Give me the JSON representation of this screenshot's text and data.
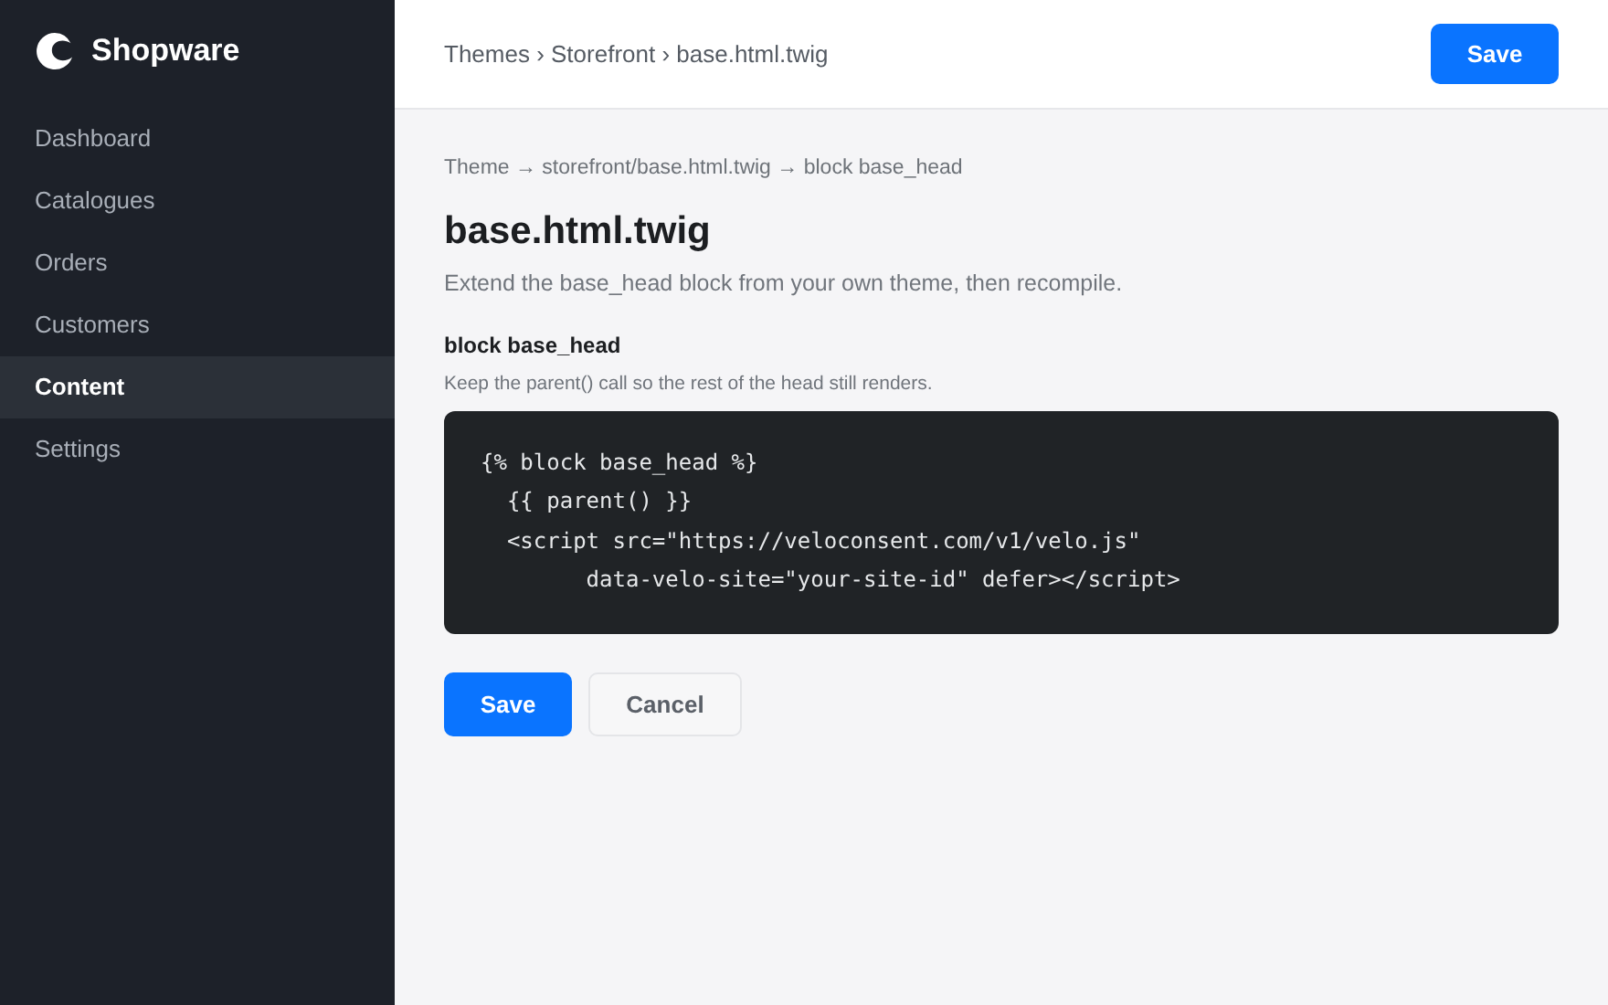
{
  "sidebar": {
    "brand": "Shopware",
    "items": [
      {
        "label": "Dashboard",
        "selected": false
      },
      {
        "label": "Catalogues",
        "selected": false
      },
      {
        "label": "Orders",
        "selected": false
      },
      {
        "label": "Customers",
        "selected": false
      },
      {
        "label": "Content",
        "selected": true
      },
      {
        "label": "Settings",
        "selected": false
      }
    ]
  },
  "header": {
    "breadcrumb": "Themes › Storefront › base.html.twig",
    "save_button": "Save"
  },
  "content": {
    "path": "Theme → storefront/base.html.twig → block base_head",
    "title": "base.html.twig",
    "subtitle": "Extend the base_head block from your own theme, then recompile.",
    "section_title": "block base_head",
    "section_hint": "Keep the parent() call so the rest of the head still renders.",
    "code_lines": [
      "{% block base_head %}",
      "  {{ parent() }}",
      "  <script src=\"https://veloconsent.com/v1/velo.js\"",
      "        data-velo-site=\"your-site-id\" defer></script>"
    ],
    "buttons": [
      {
        "label": "Save",
        "kind": "primary"
      },
      {
        "label": "Cancel",
        "kind": "secondary"
      }
    ]
  }
}
